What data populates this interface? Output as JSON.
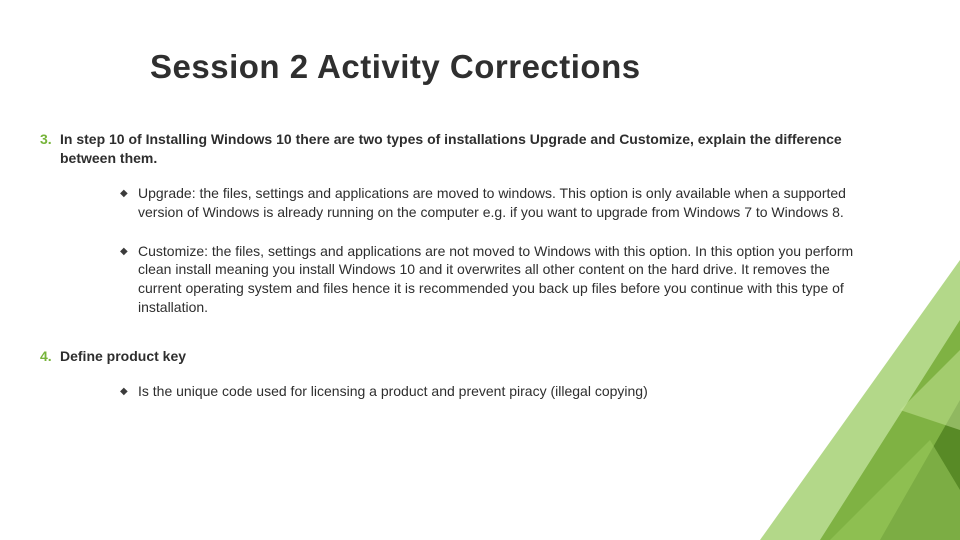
{
  "title": "Session 2 Activity Corrections",
  "accent_color": "#76b43a",
  "q3": {
    "num": "3.",
    "text": "In step 10 of Installing Windows 10 there are two types of installations Upgrade and Customize, explain the difference between them.",
    "bullets": [
      "Upgrade: the files, settings and applications are moved to windows. This option is only available when a supported version of Windows is already running on the computer e.g. if you want to upgrade from Windows 7 to Windows 8.",
      "Customize: the files, settings and applications are not moved to Windows  with this option. In this option you perform clean install meaning you install Windows 10 and it overwrites all other content on the hard drive. It removes the current operating system and files hence it is recommended you back up files before you continue with this type of installation."
    ]
  },
  "q4": {
    "num": "4.",
    "text": "Define product key",
    "bullets": [
      "Is the unique code used for licensing a product and prevent piracy (illegal copying)"
    ]
  },
  "bullet_glyph": "◆"
}
